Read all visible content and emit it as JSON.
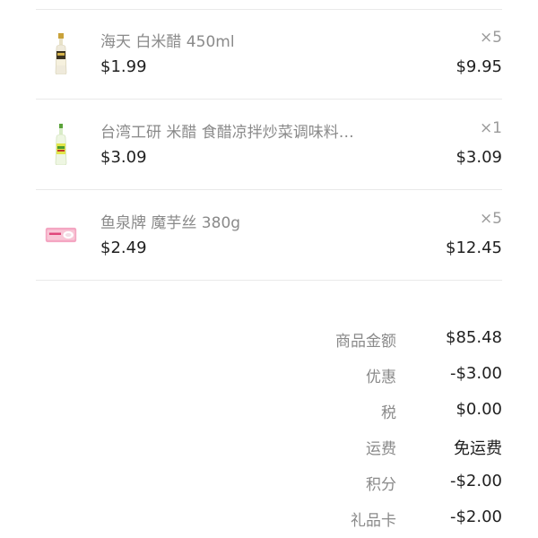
{
  "items": [
    {
      "name": "海天 白米醋 450ml",
      "price": "$1.99",
      "qty": "×5",
      "total": "$9.95",
      "thumb_icon": "vinegar-bottle-icon"
    },
    {
      "name": "台湾工研 米醋 食醋凉拌炒菜调味料…",
      "price": "$3.09",
      "qty": "×1",
      "total": "$3.09",
      "thumb_icon": "green-bottle-icon"
    },
    {
      "name": "鱼泉牌 魔芋丝 380g",
      "price": "$2.49",
      "qty": "×5",
      "total": "$12.45",
      "thumb_icon": "konjac-package-icon"
    }
  ],
  "summary": {
    "subtotal_label": "商品金额",
    "subtotal_value": "$85.48",
    "discount_label": "优惠",
    "discount_value": "-$3.00",
    "tax_label": "税",
    "tax_value": "$0.00",
    "shipping_label": "运费",
    "shipping_value": "免运费",
    "points_label": "积分",
    "points_value": "-$2.00",
    "giftcard_label": "礼品卡",
    "giftcard_value": "-$2.00"
  },
  "colors": {
    "divider": "#e9e9e9",
    "muted_text": "#8a8a8a",
    "main_text": "#1f1f1f"
  }
}
